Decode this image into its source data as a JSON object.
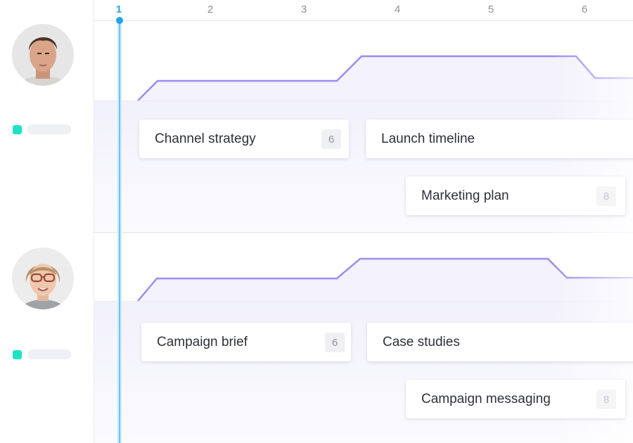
{
  "timeline": {
    "ticks": [
      {
        "label": "1",
        "current": true
      },
      {
        "label": "2",
        "current": false
      },
      {
        "label": "3",
        "current": false
      },
      {
        "label": "4",
        "current": false
      },
      {
        "label": "5",
        "current": false
      },
      {
        "label": "6",
        "current": false
      }
    ]
  },
  "people": [
    {
      "avatar_icon": "male-person-avatar",
      "legend_color": "#1de3c4",
      "tasks": [
        {
          "title": "Channel strategy",
          "count": "6"
        },
        {
          "title": "Launch timeline",
          "count": ""
        },
        {
          "title": "Marketing plan",
          "count": "8"
        }
      ]
    },
    {
      "avatar_icon": "female-person-avatar",
      "legend_color": "#1de3c4",
      "tasks": [
        {
          "title": "Campaign brief",
          "count": "6"
        },
        {
          "title": "Case studies",
          "count": ""
        },
        {
          "title": "Campaign messaging",
          "count": "8"
        }
      ]
    }
  ],
  "colors": {
    "accent": "#24a2ea",
    "workload_line": "#9b8cf0",
    "workload_fill": "#f3f2fd",
    "legend": "#1de3c4"
  }
}
